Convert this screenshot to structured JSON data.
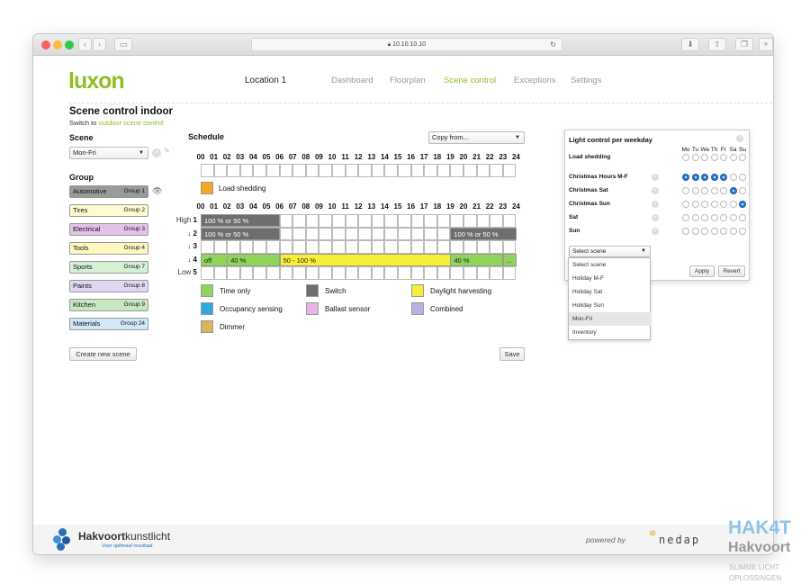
{
  "browser": {
    "url": "10.10.10.10"
  },
  "app": {
    "logo": "luxon",
    "location": "Location 1",
    "nav": [
      "Dashboard",
      "Floorplan",
      "Scene control",
      "Exceptions",
      "Settings"
    ],
    "active_nav": "Scene control"
  },
  "page": {
    "title": "Scene control indoor",
    "switch_prefix": "Switch to",
    "switch_link": "outdoor scene control"
  },
  "scene": {
    "label": "Scene",
    "value": "Mon-Fri"
  },
  "group": {
    "label": "Group",
    "items": [
      {
        "name": "Automotive",
        "num": "Group 1",
        "color": "#9a9a9a"
      },
      {
        "name": "Tires",
        "num": "Group 2",
        "color": "#fffbd0"
      },
      {
        "name": "Electrical",
        "num": "Group 3",
        "color": "#e3c3e8"
      },
      {
        "name": "Tools",
        "num": "Group 4",
        "color": "#fff7c0"
      },
      {
        "name": "Sports",
        "num": "Group 7",
        "color": "#d6f0d6"
      },
      {
        "name": "Paints",
        "num": "Group 8",
        "color": "#e0d8f2"
      },
      {
        "name": "Kitchen",
        "num": "Group 9",
        "color": "#c8e6c0"
      },
      {
        "name": "Materials",
        "num": "Group 24",
        "color": "#d0e8f8"
      }
    ]
  },
  "schedule": {
    "label": "Schedule",
    "copy_from": "Copy from...",
    "hours": [
      "00",
      "01",
      "02",
      "03",
      "04",
      "05",
      "06",
      "07",
      "08",
      "09",
      "10",
      "11",
      "12",
      "13",
      "14",
      "15",
      "16",
      "17",
      "18",
      "19",
      "20",
      "21",
      "22",
      "23",
      "24"
    ],
    "load_shedding": "Load shedding",
    "row_labels": [
      {
        "prefix": "High",
        "num": "1"
      },
      {
        "prefix": "↓",
        "num": "2"
      },
      {
        "prefix": "↓",
        "num": "3"
      },
      {
        "prefix": "↓",
        "num": "4"
      },
      {
        "prefix": "Low",
        "num": "5"
      }
    ],
    "segments": [
      {
        "row": 0,
        "from": 0,
        "to": 6,
        "text": "100 % or 50 %",
        "color": "#6e6e6e"
      },
      {
        "row": 1,
        "from": 0,
        "to": 6,
        "text": "100 % or 50 %",
        "color": "#6e6e6e"
      },
      {
        "row": 1,
        "from": 19,
        "to": 24,
        "text": "100 % or 50 %",
        "color": "#6e6e6e"
      },
      {
        "row": 3,
        "from": 0,
        "to": 2,
        "text": "off",
        "color": "#8fd45a"
      },
      {
        "row": 3,
        "from": 2,
        "to": 6,
        "text": "40 %",
        "color": "#8fd45a"
      },
      {
        "row": 3,
        "from": 6,
        "to": 19,
        "text": "50 - 100 %",
        "color": "#f6ef3a"
      },
      {
        "row": 3,
        "from": 19,
        "to": 23,
        "text": "40 %",
        "color": "#8fd45a"
      },
      {
        "row": 3,
        "from": 23,
        "to": 24,
        "text": "...",
        "color": "#8fd45a"
      }
    ],
    "legend": [
      {
        "text": "Time only",
        "color": "#8fd45a"
      },
      {
        "text": "Switch",
        "color": "#6e6e6e"
      },
      {
        "text": "Daylight harvesting",
        "color": "#f6ef3a"
      },
      {
        "text": "Occupancy sensing",
        "color": "#2ea8dc"
      },
      {
        "text": "Ballast sensor",
        "color": "#e8b4e8"
      },
      {
        "text": "Combined",
        "color": "#b8b0e8"
      },
      {
        "text": "Dimmer",
        "color": "#d8b45a"
      }
    ],
    "load_shedding_color": "#f5a623"
  },
  "buttons": {
    "create": "Create new scene",
    "save": "Save"
  },
  "weekday_panel": {
    "title": "Light control per weekday",
    "days": [
      "Mo",
      "Tu",
      "We",
      "Th",
      "Fr",
      "Sa",
      "Su"
    ],
    "rows": [
      {
        "name": "Load shedding",
        "selected": []
      },
      {
        "name": "Christmas Hours M-F",
        "selected": [
          0,
          1,
          2,
          3,
          4
        ]
      },
      {
        "name": "Christmas Sat",
        "selected": [
          5
        ]
      },
      {
        "name": "Christmas Sun",
        "selected": [
          6
        ]
      },
      {
        "name": "Sat",
        "selected": []
      },
      {
        "name": "Sun",
        "selected": []
      }
    ],
    "select_scene": "Select scene",
    "dropdown": [
      "Select scene",
      "Holiday M-F",
      "Holiday Sat",
      "Holiday Sun",
      "Mon-Fri",
      "Inventory"
    ],
    "dropdown_highlight": "Mon-Fri",
    "apply": "Apply",
    "revert": "Revert"
  },
  "footer": {
    "brand_bold": "Hakvoort",
    "brand_light": "kunstlicht",
    "tagline": "Voor optimaal resultaat",
    "powered_by": "powered by",
    "partner": "nedap"
  },
  "watermark": {
    "line1": "HAK4T",
    "line2": "Hakvoort",
    "line3": "SLIMME LICHT",
    "line4": "OPLOSSINGEN"
  }
}
